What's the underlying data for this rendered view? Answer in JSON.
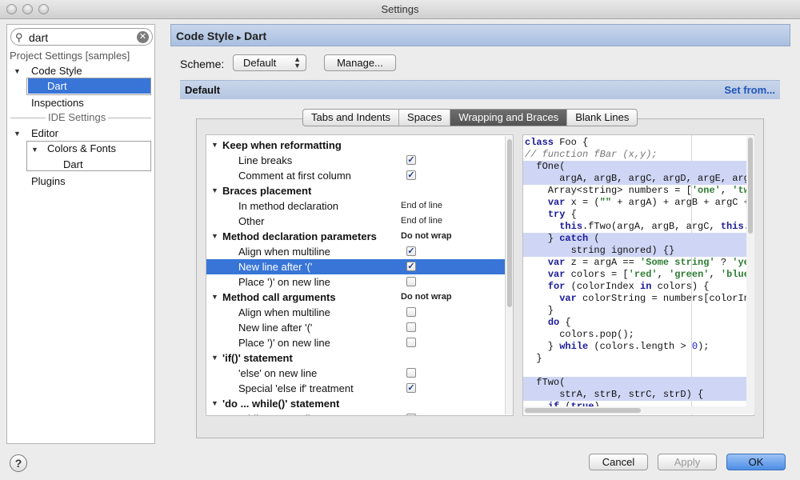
{
  "window": {
    "title": "Settings"
  },
  "search": {
    "value": "dart"
  },
  "sidebar": {
    "project_settings_label": "Project Settings [samples]",
    "code_style": "Code Style",
    "dart": "Dart",
    "inspections": "Inspections",
    "ide_settings_label": "IDE Settings",
    "editor": "Editor",
    "colors_fonts": "Colors & Fonts",
    "dart_editor": "Dart",
    "plugins": "Plugins"
  },
  "header": {
    "crumb_parent": "Code Style",
    "crumb_sep": "▸",
    "crumb_child": "Dart"
  },
  "scheme": {
    "label": "Scheme:",
    "value": "Default",
    "manage_label": "Manage..."
  },
  "default_bar": {
    "label": "Default",
    "set_from": "Set from..."
  },
  "tabs": [
    {
      "label": "Tabs and Indents",
      "active": false
    },
    {
      "label": "Spaces",
      "active": false
    },
    {
      "label": "Wrapping and Braces",
      "active": true
    },
    {
      "label": "Blank Lines",
      "active": false
    }
  ],
  "options": [
    {
      "type": "section",
      "label": "Keep when reformatting"
    },
    {
      "type": "check",
      "label": "Line breaks",
      "checked": true
    },
    {
      "type": "check",
      "label": "Comment at first column",
      "checked": true
    },
    {
      "type": "section",
      "label": "Braces placement"
    },
    {
      "type": "value",
      "label": "In method declaration",
      "value": "End of line"
    },
    {
      "type": "value",
      "label": "Other",
      "value": "End of line"
    },
    {
      "type": "section",
      "label": "Method declaration parameters",
      "value": "Do not wrap"
    },
    {
      "type": "check",
      "label": "Align when multiline",
      "checked": true
    },
    {
      "type": "check",
      "label": "New line after '('",
      "checked": true,
      "selected": true
    },
    {
      "type": "check",
      "label": "Place ')' on new line",
      "checked": false
    },
    {
      "type": "section",
      "label": "Method call arguments",
      "value": "Do not wrap"
    },
    {
      "type": "check",
      "label": "Align when multiline",
      "checked": false
    },
    {
      "type": "check",
      "label": "New line after '('",
      "checked": false
    },
    {
      "type": "check",
      "label": "Place ')' on new line",
      "checked": false
    },
    {
      "type": "section",
      "label": "'if()' statement"
    },
    {
      "type": "check",
      "label": "'else' on new line",
      "checked": false
    },
    {
      "type": "check",
      "label": "Special 'else if' treatment",
      "checked": true
    },
    {
      "type": "section",
      "label": "'do ... while()' statement"
    },
    {
      "type": "check",
      "label": "'while' on new line",
      "checked": false
    }
  ],
  "code": [
    {
      "text": "class Foo {",
      "hl": false
    },
    {
      "text": "// function fBar (x,y);",
      "hl": false,
      "comment": true
    },
    {
      "text": "  fOne(",
      "hl": true
    },
    {
      "text": "      argA, argB, argC, argD, argE, argF",
      "hl": true
    },
    {
      "text": "    Array<string> numbers = ['one', 'two",
      "hl": false
    },
    {
      "text": "    var x = (\"\" + argA) + argB + argC +",
      "hl": false
    },
    {
      "text": "    try {",
      "hl": false
    },
    {
      "text": "      this.fTwo(argA, argB, argC, this.f",
      "hl": false
    },
    {
      "text": "    } catch (",
      "hl": true
    },
    {
      "text": "        string ignored) {}",
      "hl": true
    },
    {
      "text": "    var z = argA == 'Some string' ? 'yes",
      "hl": false
    },
    {
      "text": "    var colors = ['red', 'green', 'blue'",
      "hl": false
    },
    {
      "text": "    for (colorIndex in colors) {",
      "hl": false
    },
    {
      "text": "      var colorString = numbers[colorInd",
      "hl": false
    },
    {
      "text": "    }",
      "hl": false
    },
    {
      "text": "    do {",
      "hl": false
    },
    {
      "text": "      colors.pop();",
      "hl": false
    },
    {
      "text": "    } while (colors.length > 0);",
      "hl": false
    },
    {
      "text": "  }",
      "hl": false
    },
    {
      "text": "",
      "hl": false
    },
    {
      "text": "  fTwo(",
      "hl": true
    },
    {
      "text": "      strA, strB, strC, strD) {",
      "hl": true
    },
    {
      "text": "    if (true)",
      "hl": false
    }
  ],
  "footer": {
    "help": "?",
    "cancel": "Cancel",
    "apply": "Apply",
    "ok": "OK"
  },
  "colors": {
    "selection": "#3875d7",
    "header": "#b3c6e4",
    "code_highlight": "#cfd6f5",
    "link": "#1f55b8"
  }
}
